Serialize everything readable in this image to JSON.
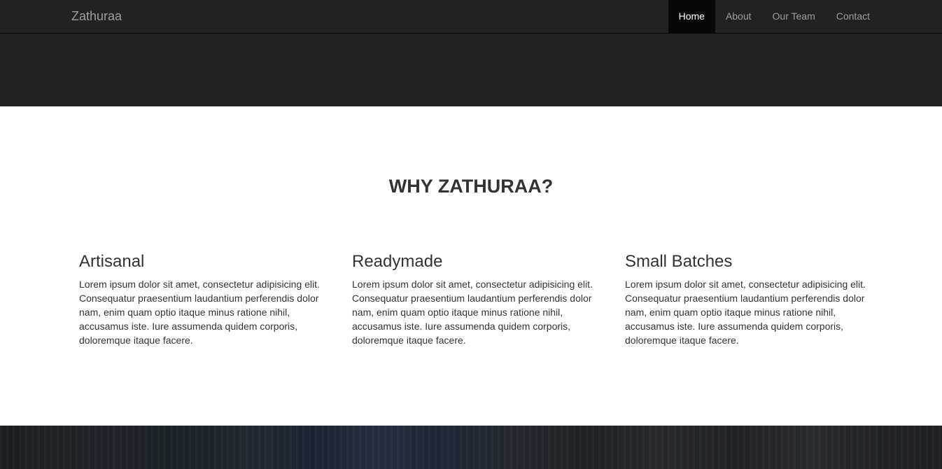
{
  "navbar": {
    "brand": "Zathuraa",
    "items": [
      {
        "label": "Home",
        "active": true
      },
      {
        "label": "About",
        "active": false
      },
      {
        "label": "Our Team",
        "active": false
      },
      {
        "label": "Contact",
        "active": false
      }
    ]
  },
  "features": {
    "heading": "WHY ZATHURAA?",
    "columns": [
      {
        "title": "Artisanal",
        "text": "Lorem ipsum dolor sit amet, consectetur adipisicing elit. Consequatur praesentium laudantium perferendis dolor nam, enim quam optio itaque minus ratione nihil, accusamus iste. Iure assumenda quidem corporis, doloremque itaque facere."
      },
      {
        "title": "Readymade",
        "text": "Lorem ipsum dolor sit amet, consectetur adipisicing elit. Consequatur praesentium laudantium perferendis dolor nam, enim quam optio itaque minus ratione nihil, accusamus iste. Iure assumenda quidem corporis, doloremque itaque facere."
      },
      {
        "title": "Small Batches",
        "text": "Lorem ipsum dolor sit amet, consectetur adipisicing elit. Consequatur praesentium laudantium perferendis dolor nam, enim quam optio itaque minus ratione nihil, accusamus iste. Iure assumenda quidem corporis, doloremque itaque facere."
      }
    ]
  },
  "colors": {
    "navbar_bg": "#222222",
    "active_item_bg": "#080808",
    "nav_text": "#9d9d9d",
    "active_text": "#ffffff",
    "body_text": "#333333"
  }
}
